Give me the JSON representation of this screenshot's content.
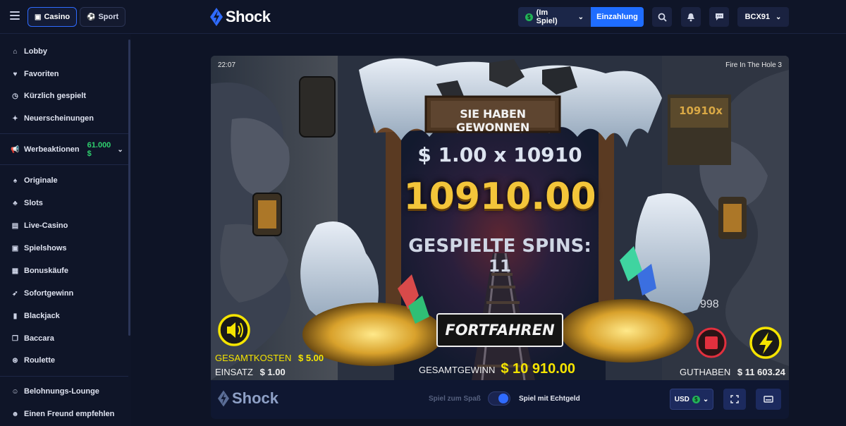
{
  "topbar": {
    "casino_label": "Casino",
    "sport_label": "Sport",
    "brand": "Shock",
    "balance_label": "(Im Spiel)",
    "deposit_label": "Einzahlung",
    "username": "BCX91"
  },
  "sidebar": {
    "items": [
      {
        "label": "Lobby",
        "icon": "home-icon"
      },
      {
        "label": "Favoriten",
        "icon": "heart-icon"
      },
      {
        "label": "Kürzlich gespielt",
        "icon": "history-icon"
      },
      {
        "label": "Neuerscheinungen",
        "icon": "sparkle-icon"
      }
    ],
    "promo": {
      "label": "Werbeaktionen",
      "value": "61.000 $"
    },
    "categories": [
      {
        "label": "Originale",
        "icon": "spade-icon"
      },
      {
        "label": "Slots",
        "icon": "cherry-icon"
      },
      {
        "label": "Live-Casino",
        "icon": "live-icon"
      },
      {
        "label": "Spielshows",
        "icon": "tv-icon"
      },
      {
        "label": "Bonuskäufe",
        "icon": "gift-icon"
      },
      {
        "label": "Sofortgewinn",
        "icon": "rocket-icon"
      },
      {
        "label": "Blackjack",
        "icon": "card-icon"
      },
      {
        "label": "Baccara",
        "icon": "cards-icon"
      },
      {
        "label": "Roulette",
        "icon": "roulette-icon"
      }
    ],
    "bottom": [
      {
        "label": "Belohnungs-Lounge",
        "icon": "person-icon"
      },
      {
        "label": "Einen Freund empfehlen",
        "icon": "friends-icon"
      }
    ]
  },
  "game": {
    "time": "22:07",
    "title": "Fire In The Hole 3",
    "multiplier_sign": "10910x",
    "banner": "SIE HABEN GEWONNEN",
    "bet_formula": "$ 1.00 x 10910",
    "win_amount": "10910.00",
    "spins_label": "GESPIELTE SPINS:",
    "spins_value": "11",
    "continue_label": "FORTFAHREN",
    "counter": "998",
    "total_cost_label": "GESAMTKOSTEN",
    "total_cost_value": "$ 5.00",
    "bet_label": "EINSATZ",
    "bet_value": "$ 1.00",
    "total_win_label": "GESAMTGEWINN",
    "total_win_value": "$ 10 910.00",
    "balance_label": "GUTHABEN",
    "balance_value": "$ 11 603.24"
  },
  "footer": {
    "brand": "Shock",
    "demo_label": "Spiel zum Spaß",
    "real_label": "Spiel mit Echtgeld",
    "currency": "USD"
  },
  "colors": {
    "accent": "#1f6dff",
    "promo_green": "#2fd06e",
    "gold": "#f3c53a",
    "game_yellow": "#f5e400"
  }
}
